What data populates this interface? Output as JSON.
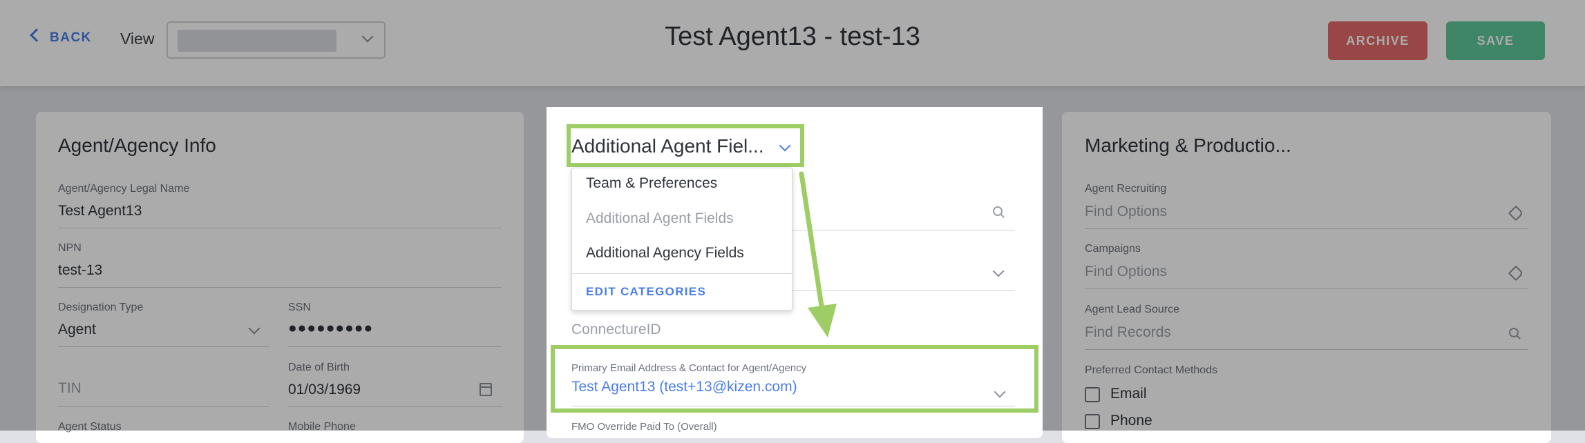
{
  "header": {
    "back_label": "BACK",
    "view_label": "View",
    "view_select_value": "",
    "title": "Test Agent13 - test-13",
    "archive_label": "ARCHIVE",
    "save_label": "SAVE"
  },
  "left_card": {
    "title": "Agent/Agency Info",
    "legal_name_label": "Agent/Agency Legal Name",
    "legal_name_value": "Test Agent13",
    "npn_label": "NPN",
    "npn_value": "test-13",
    "designation_label": "Designation Type",
    "designation_value": "Agent",
    "ssn_label": "SSN",
    "ssn_value": "●●●●●●●●●",
    "tin_placeholder": "TIN",
    "dob_label": "Date of Birth",
    "dob_value": "01/03/1969",
    "agent_status_label": "Agent Status",
    "mobile_phone_label": "Mobile Phone"
  },
  "middle_card": {
    "category_selected": "Additional Agent Fiel...",
    "dropdown_options": [
      "Team & Preferences",
      "Additional Agent Fields",
      "Additional Agency Fields"
    ],
    "edit_categories_label": "EDIT CATEGORIES",
    "connecture_placeholder": "ConnectureID",
    "primary_email_label": "Primary Email Address & Contact for Agent/Agency",
    "primary_email_value": "Test Agent13 (test+13@kizen.com)",
    "fmo_label": "FMO Override Paid To (Overall)"
  },
  "right_card": {
    "title": "Marketing & Productio...",
    "recruiting_label": "Agent Recruiting",
    "recruiting_placeholder": "Find Options",
    "campaigns_label": "Campaigns",
    "campaigns_placeholder": "Find Options",
    "lead_source_label": "Agent Lead Source",
    "lead_source_placeholder": "Find Records",
    "contact_methods_label": "Preferred Contact Methods",
    "contact_methods": [
      "Email",
      "Phone"
    ]
  },
  "colors": {
    "accent_blue": "#4a7de8",
    "archive_red": "#e36a6b",
    "save_green": "#5ec79b",
    "highlight_green": "#9dcd64"
  }
}
